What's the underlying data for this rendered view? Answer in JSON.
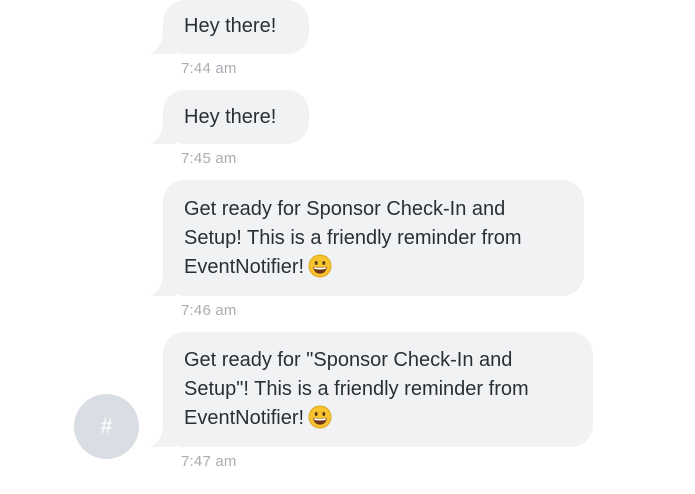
{
  "messages": [
    {
      "lines": [
        "Hey there!"
      ],
      "time": "7:44 am"
    },
    {
      "lines": [
        "Hey there!"
      ],
      "time": "7:45 am"
    },
    {
      "lines": [
        "Get ready for Sponsor Check-In and",
        "Setup! This is a friendly reminder from",
        "EventNotifier!"
      ],
      "emoji": "grinning-face-emoji",
      "time": "7:46 am"
    },
    {
      "lines": [
        "Get ready for \"Sponsor Check-In and",
        "Setup\"! This is a friendly reminder from",
        "EventNotifier!"
      ],
      "emoji": "grinning-face-emoji",
      "time": "7:47 am"
    }
  ],
  "avatar": {
    "symbol": "#"
  },
  "colors": {
    "bubble_background": "#f1f2f4",
    "text": "#2b2f33",
    "timestamp": "#a9adb2",
    "avatar_background": "#d9dee4"
  }
}
